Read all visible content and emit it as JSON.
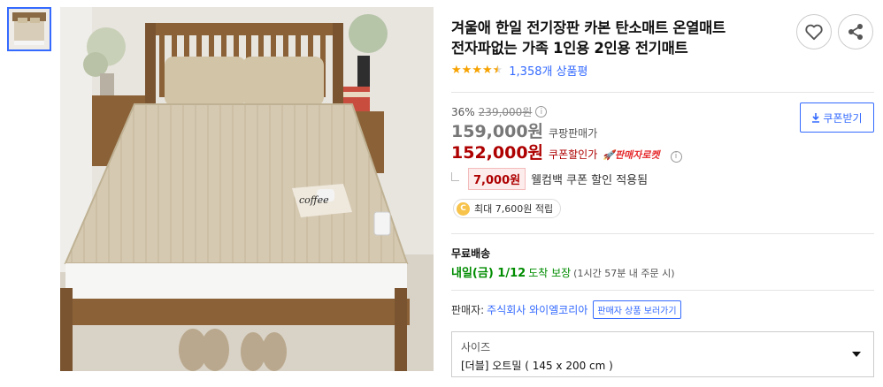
{
  "gallery": {
    "thumbnail_icon": "bed-photo-thumbnail",
    "main_image_icon": "bed-with-carbon-mat-photo",
    "main_image_label": "coffee"
  },
  "product": {
    "title_line1": "겨울애 한일 전기장판 카본 탄소매트 온열매트",
    "title_line2": "전자파없는 가족 1인용 2인용 전기매트",
    "rating_stars": 4.5,
    "review_count": "1,358개 상품평"
  },
  "actions": {
    "wishlist_icon": "heart-icon",
    "share_icon": "share-icon"
  },
  "price": {
    "discount_rate": "36%",
    "original_price": "239,000원",
    "sale_price": "159,000원",
    "sale_label": "쿠팡판매가",
    "coupon_price": "152,000원",
    "coupon_label": "쿠폰할인가",
    "rocket_badge": "판매자로켓",
    "coupon_button": "쿠폰받기",
    "welcome_amount": "7,000원",
    "welcome_text": "웰컴백 쿠폰 할인 적용됨",
    "cash_text": "최대 7,600원 적립",
    "cash_icon_letter": "C"
  },
  "shipping": {
    "title": "무료배송",
    "date": "내일(금) 1/12",
    "guarantee": "도착 보장",
    "note": "(1시간 57분 내 주문 시)"
  },
  "seller": {
    "label": "판매자:",
    "name": "주식회사 와이엘코리아",
    "button": "판매자 상품 보러가기"
  },
  "option": {
    "label": "사이즈",
    "value": "[더블] 오트밀 ( 145 x 200 cm )"
  },
  "colors": {
    "accent_blue": "#346aff",
    "price_red": "#ae0000",
    "ship_green": "#008c00",
    "star": "#f6a201"
  }
}
